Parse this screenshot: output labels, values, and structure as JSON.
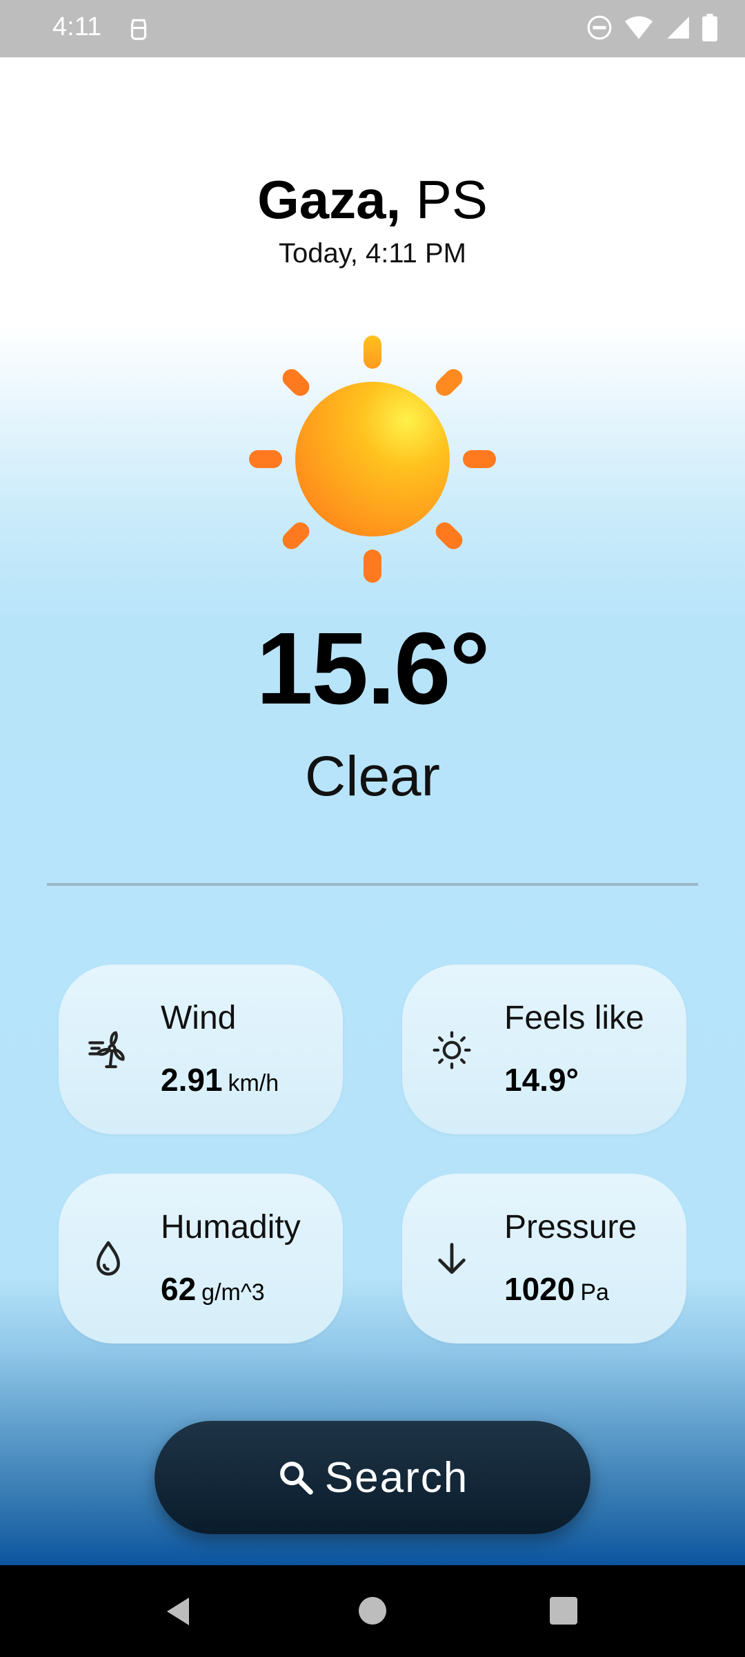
{
  "status_bar": {
    "time": "4:11",
    "icons": [
      "app-notification-icon",
      "do-not-disturb-icon",
      "wifi-icon",
      "signal-icon",
      "battery-icon"
    ]
  },
  "header": {
    "city": "Gaza,",
    "country": "PS",
    "datetime": "Today, 4:11 PM"
  },
  "weather": {
    "icon": "sun-icon",
    "temperature": "15.6°",
    "condition": "Clear"
  },
  "cards": {
    "wind": {
      "label": "Wind",
      "value": "2.91",
      "unit": "km/h",
      "icon": "wind-turbine-icon"
    },
    "feels_like": {
      "label": "Feels like",
      "value": "14.9°",
      "icon": "sun-outline-icon"
    },
    "humidity": {
      "label": "Humadity",
      "value": "62",
      "unit": "g/m^3",
      "icon": "water-drop-icon"
    },
    "pressure": {
      "label": "Pressure",
      "value": "1020",
      "unit": "Pa",
      "icon": "arrow-down-icon"
    }
  },
  "search": {
    "label": "Search",
    "icon": "search-icon"
  },
  "nav_bar": {
    "icons": [
      "back-icon",
      "home-icon",
      "recents-icon"
    ]
  },
  "colors": {
    "status_bar": "#bdbdbd",
    "sun_orange": "#ff7a1f",
    "card_bg": "#e4f5fd",
    "search_bg": "#0f2333",
    "sky_bottom": "#0b55a0"
  }
}
